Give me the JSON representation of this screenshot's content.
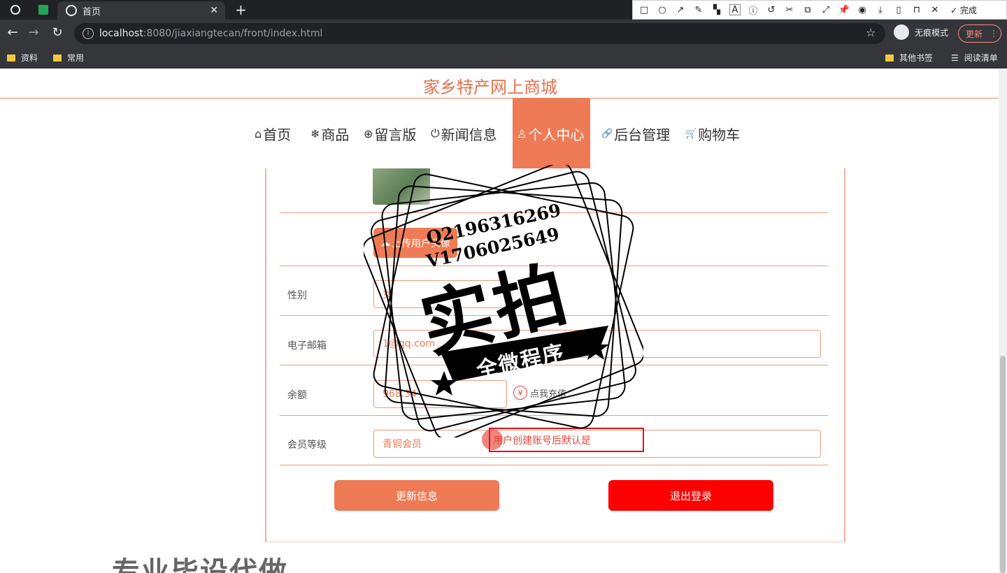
{
  "browser": {
    "tab_title": "首页",
    "url_host": "localhost",
    "url_rest": ":8080/jiaxiangtecan/front/index.html",
    "incognito_label": "无痕模式",
    "update_label": "更新",
    "bookmarks": [
      "资料",
      "常用"
    ],
    "bookmarks_right": [
      "其他书签",
      "阅读清单"
    ]
  },
  "annot_toolbar": {
    "done_label": "完成",
    "font_size": "12",
    "current_color": "#f03030",
    "palette": [
      "#000000",
      "#808080",
      "#800000",
      "#ff8000",
      "#008000",
      "#0000ff",
      "#800080",
      "#008080",
      "#ffffff",
      "#c0c0c0",
      "#ff0000",
      "#ffff00",
      "#80ff00",
      "#00a0ff",
      "#ff00ff",
      "#00ffff"
    ]
  },
  "site": {
    "title": "家乡特产网上商城",
    "nav": [
      {
        "label": "首页",
        "icon": "home-icon",
        "glyph": "⌂"
      },
      {
        "label": "商品",
        "icon": "snowflake-icon",
        "glyph": "❄"
      },
      {
        "label": "留言版",
        "icon": "globe-icon",
        "glyph": "⊕"
      },
      {
        "label": "新闻信息",
        "icon": "power-icon",
        "glyph": "⏻"
      },
      {
        "label": "个人中心",
        "icon": "user-icon",
        "glyph": "♙"
      },
      {
        "label": "后台管理",
        "icon": "link-icon",
        "glyph": "🔗"
      },
      {
        "label": "购物车",
        "icon": "cart-icon",
        "glyph": "🛒"
      }
    ]
  },
  "profile": {
    "upload_label": "上传用户头像",
    "gender_label": "性别",
    "gender_value": "女",
    "email_label": "电子邮箱",
    "email_value": "1@qq.com",
    "balance_label": "余额",
    "balance_value": "968.34",
    "recharge_label": "点我充值",
    "recharge_icon": "yen-icon",
    "level_label": "会员等级",
    "level_value": "青铜会员",
    "update_button": "更新信息",
    "logout_button": "退出登录"
  },
  "overlay": {
    "annotation_text": "用户创建账号后默认是",
    "stamp_contact_q": "Q2196316269",
    "stamp_contact_v": "V1706025649",
    "stamp_main": "实拍",
    "stamp_banner": "全微程序",
    "bottom_text": "专业毕设代做"
  }
}
